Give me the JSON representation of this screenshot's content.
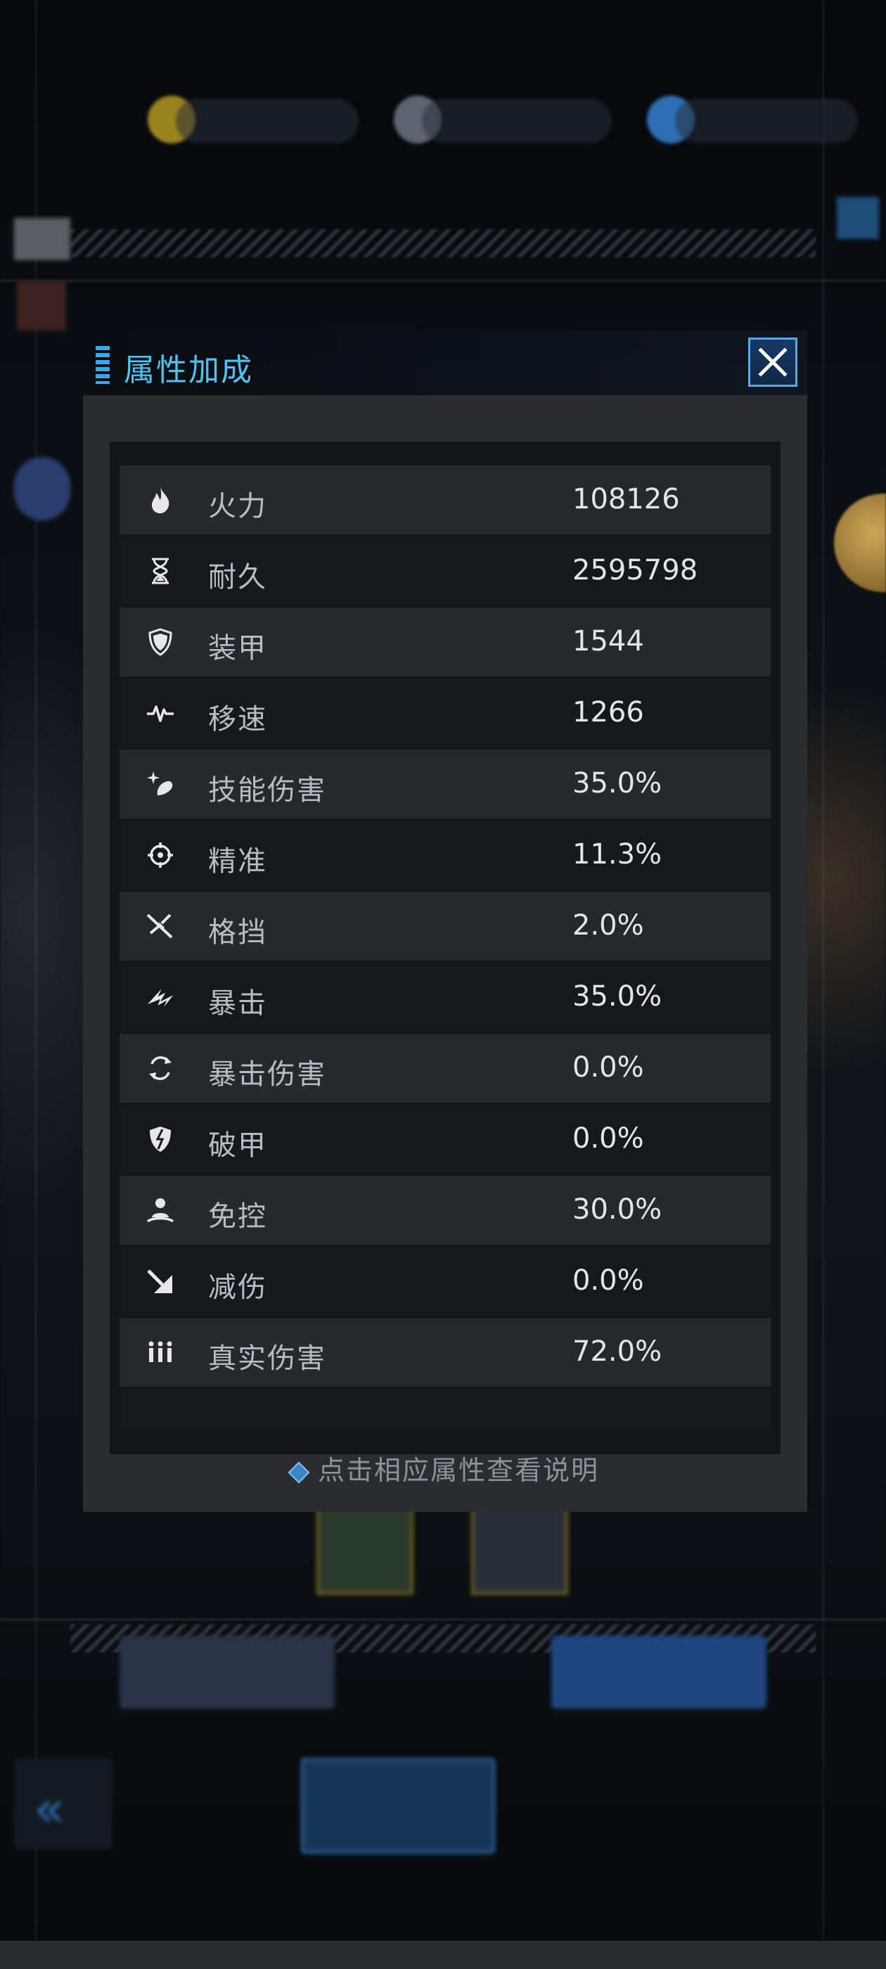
{
  "dialog": {
    "title": "属性加成",
    "close_label": "×"
  },
  "attributes": [
    {
      "icon": "flame-icon",
      "label": "火力",
      "value": "108126"
    },
    {
      "icon": "hourglass-icon",
      "label": "耐久",
      "value": "2595798"
    },
    {
      "icon": "shield-icon",
      "label": "装甲",
      "value": "1544"
    },
    {
      "icon": "speed-pulse-icon",
      "label": "移速",
      "value": "1266"
    },
    {
      "icon": "skill-damage-icon",
      "label": "技能伤害",
      "value": "35.0%"
    },
    {
      "icon": "crosshair-icon",
      "label": "精准",
      "value": "11.3%"
    },
    {
      "icon": "parry-icon",
      "label": "格挡",
      "value": "2.0%"
    },
    {
      "icon": "critical-icon",
      "label": "暴击",
      "value": "35.0%"
    },
    {
      "icon": "crit-damage-icon",
      "label": "暴击伤害",
      "value": "0.0%"
    },
    {
      "icon": "armor-break-icon",
      "label": "破甲",
      "value": "0.0%"
    },
    {
      "icon": "control-immune-icon",
      "label": "免控",
      "value": "30.0%"
    },
    {
      "icon": "damage-reduction-icon",
      "label": "减伤",
      "value": "0.0%"
    },
    {
      "icon": "true-damage-icon",
      "label": "真实伤害",
      "value": "72.0%"
    }
  ],
  "hint": "点击相应属性查看说明",
  "colors": {
    "accent": "#4ec2f2",
    "panel": "#2a2c30",
    "row_dark": "#17181b",
    "row_light": "#26282b"
  }
}
